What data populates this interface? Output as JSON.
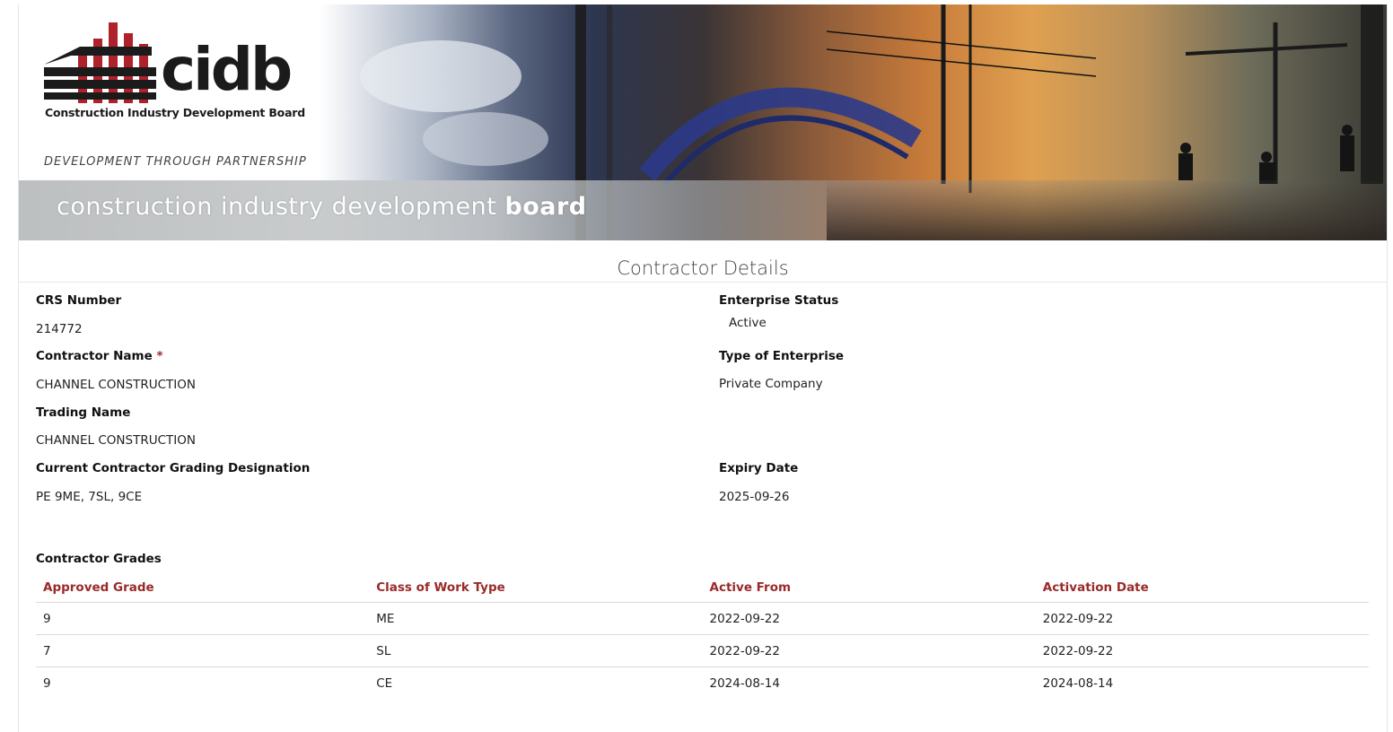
{
  "banner": {
    "logo_word": "cidb",
    "logo_subtitle": "Construction Industry Development Board",
    "tagline": "DEVELOPMENT THROUGH PARTNERSHIP",
    "band_text_light": "construction industry development",
    "band_text_bold": "board"
  },
  "section": {
    "title": "Contractor Details"
  },
  "fields": {
    "crs_number": {
      "label": "CRS Number",
      "value": "214772"
    },
    "enterprise_status": {
      "label": "Enterprise Status",
      "value": "Active"
    },
    "contractor_name": {
      "label": "Contractor Name",
      "required_mark": "*",
      "value": "CHANNEL CONSTRUCTION"
    },
    "type_of_enterprise": {
      "label": "Type of Enterprise",
      "value": "Private Company"
    },
    "trading_name": {
      "label": "Trading Name",
      "value": "CHANNEL CONSTRUCTION"
    },
    "grading_designation": {
      "label": "Current Contractor Grading Designation",
      "value": "PE 9ME, 7SL, 9CE"
    },
    "expiry_date": {
      "label": "Expiry Date",
      "value": "2025-09-26"
    }
  },
  "grades": {
    "title": "Contractor Grades",
    "columns": [
      "Approved Grade",
      "Class of Work Type",
      "Active From",
      "Activation Date"
    ],
    "rows": [
      [
        "9",
        "ME",
        "2022-09-22",
        "2022-09-22"
      ],
      [
        "7",
        "SL",
        "2022-09-22",
        "2022-09-22"
      ],
      [
        "9",
        "CE",
        "2024-08-14",
        "2024-08-14"
      ]
    ]
  },
  "colors": {
    "accent_red": "#9a2a2a",
    "logo_red": "#b0222b"
  }
}
